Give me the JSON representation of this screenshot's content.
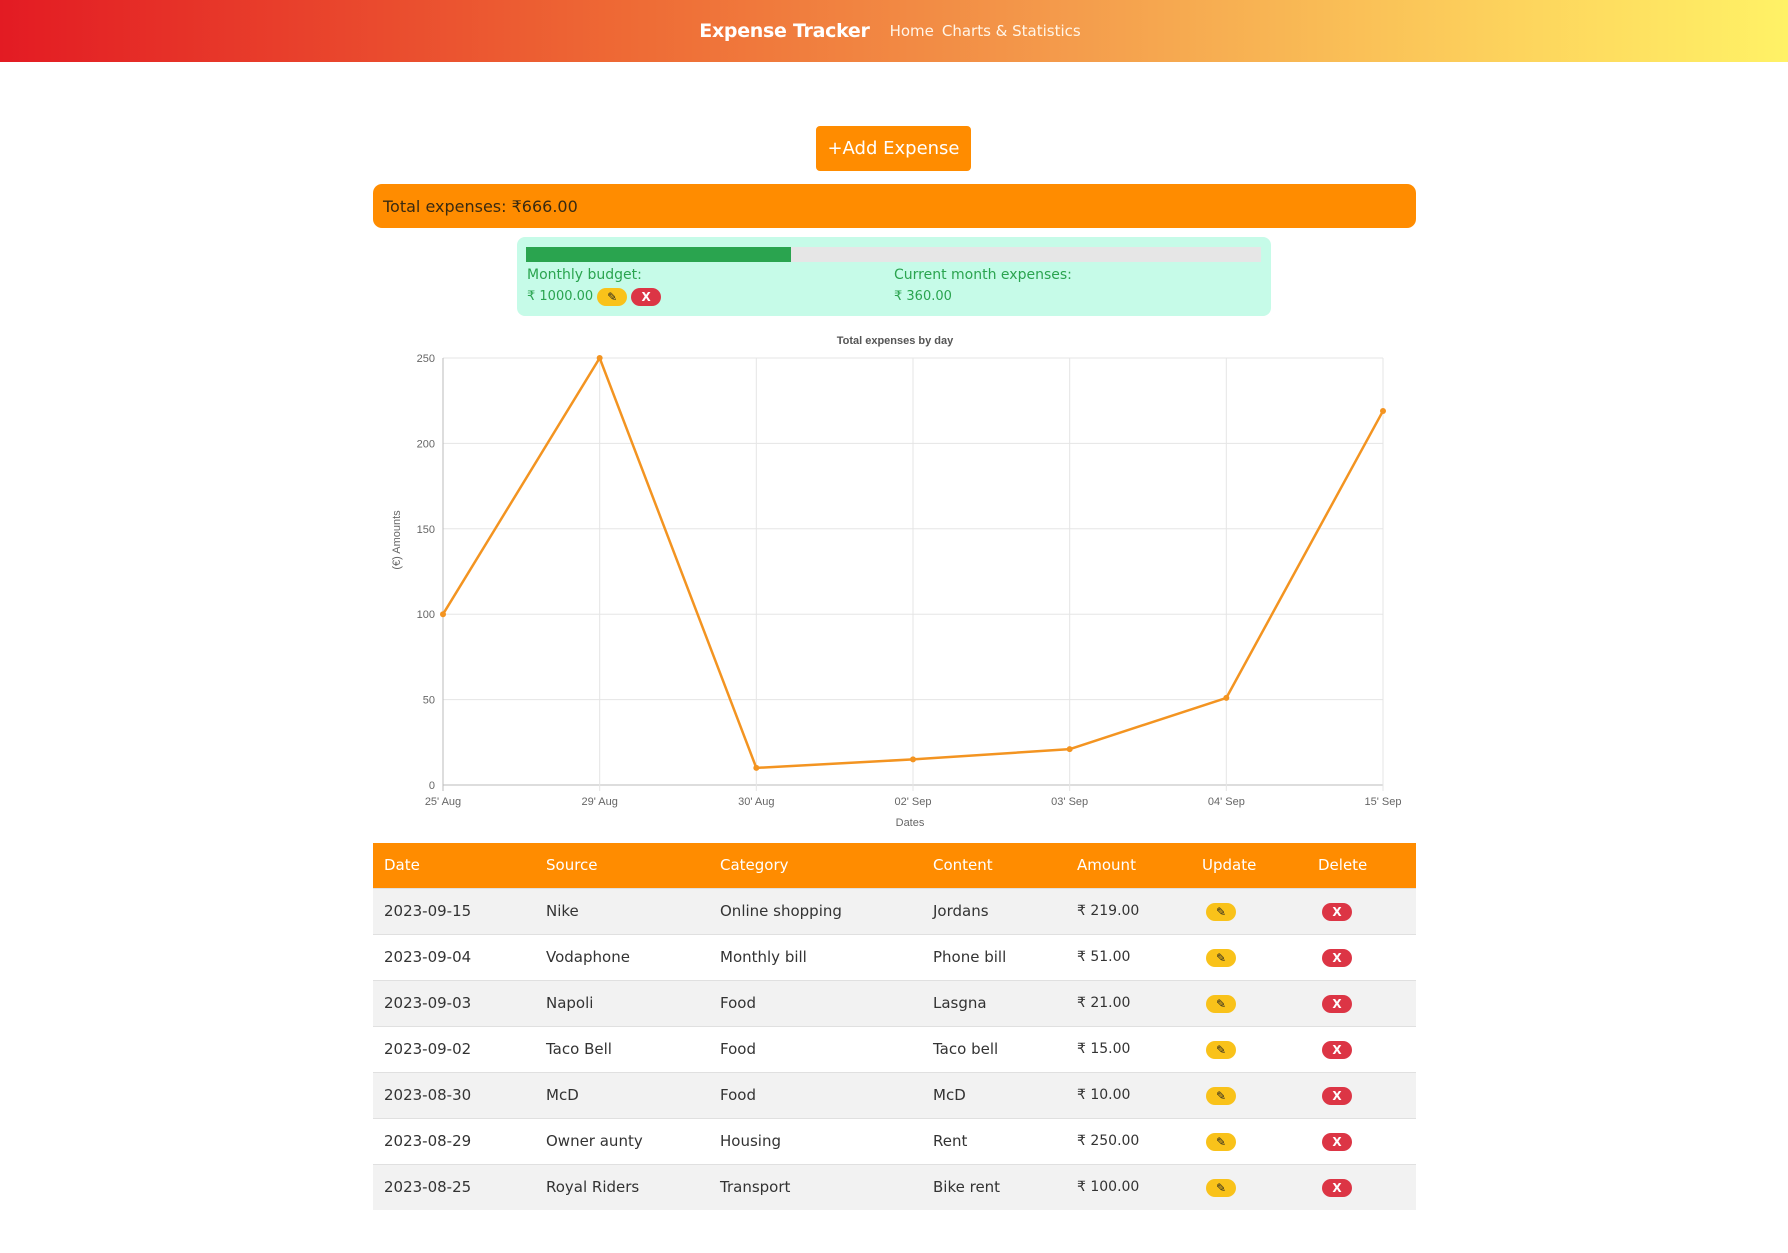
{
  "nav": {
    "brand": "Expense Tracker",
    "links": [
      "Home",
      "Charts & Statistics"
    ]
  },
  "add_button": "+Add Expense",
  "total": {
    "text": "Total expenses: ₹666.00"
  },
  "budget": {
    "progress_percent": 36,
    "budget_label": "Monthly budget:",
    "budget_value": "₹ 1000.00",
    "current_label": "Current month expenses:",
    "current_value": "₹ 360.00",
    "edit_glyph": "✎",
    "delete_glyph": "X"
  },
  "colors": {
    "accent": "#ff8c00",
    "progress": "#2aa44f",
    "edit": "#f9c21a",
    "delete": "#dc3545",
    "line": "#f39421"
  },
  "chart_data": {
    "type": "line",
    "title": "Total expenses by day",
    "xlabel": "Dates",
    "ylabel": "(€) Amounts",
    "categories": [
      "25' Aug",
      "29' Aug",
      "30' Aug",
      "02' Sep",
      "03' Sep",
      "04' Sep",
      "15' Sep"
    ],
    "series": [
      {
        "values": [
          100,
          250,
          10,
          15,
          21,
          51,
          219
        ]
      }
    ],
    "ylim": [
      0,
      250
    ],
    "yticks": [
      0,
      50,
      100,
      150,
      200,
      250
    ],
    "grid": true,
    "legend": "none"
  },
  "table": {
    "headers": [
      "Date",
      "Source",
      "Category",
      "Content",
      "Amount",
      "Update",
      "Delete"
    ],
    "rows": [
      [
        "2023-09-15",
        "Nike",
        "Online shopping",
        "Jordans",
        "₹ 219.00"
      ],
      [
        "2023-09-04",
        "Vodaphone",
        "Monthly bill",
        "Phone bill",
        "₹ 51.00"
      ],
      [
        "2023-09-03",
        "Napoli",
        "Food",
        "Lasgna",
        "₹ 21.00"
      ],
      [
        "2023-09-02",
        "Taco Bell",
        "Food",
        "Taco bell",
        "₹ 15.00"
      ],
      [
        "2023-08-30",
        "McD",
        "Food",
        "McD",
        "₹ 10.00"
      ],
      [
        "2023-08-29",
        "Owner aunty",
        "Housing",
        "Rent",
        "₹ 250.00"
      ],
      [
        "2023-08-25",
        "Royal Riders",
        "Transport",
        "Bike rent",
        "₹ 100.00"
      ]
    ]
  }
}
